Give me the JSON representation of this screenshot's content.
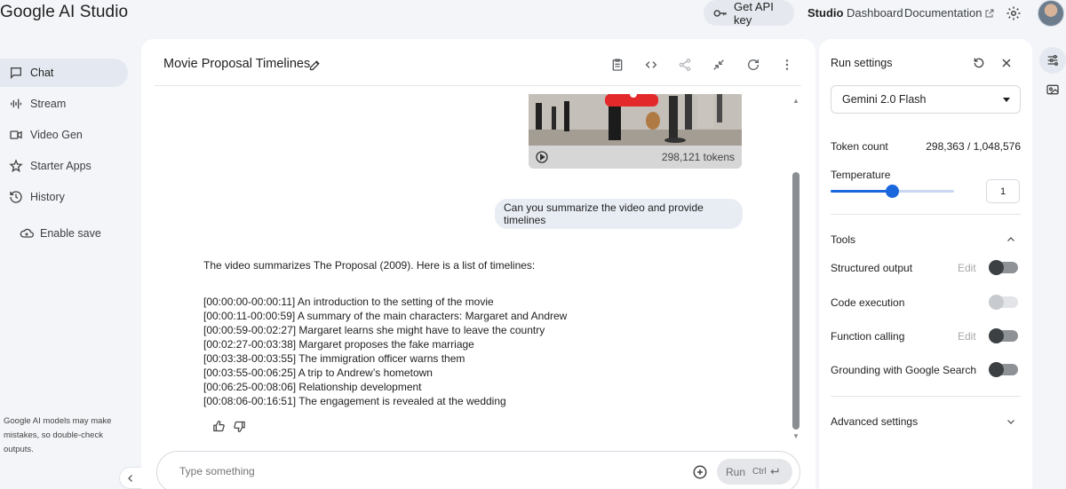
{
  "app": {
    "logo": "Google AI Studio"
  },
  "header": {
    "api_key_label": "Get API key",
    "nav": {
      "studio": "Studio",
      "dashboard": "Dashboard",
      "documentation": "Documentation"
    }
  },
  "sidebar": {
    "items": [
      {
        "label": "Chat",
        "icon": "chat-icon",
        "active": true
      },
      {
        "label": "Stream",
        "icon": "waveform-icon"
      },
      {
        "label": "Video Gen",
        "icon": "video-camera-icon"
      },
      {
        "label": "Starter Apps",
        "icon": "starter-apps-icon"
      },
      {
        "label": "History",
        "icon": "history-icon"
      }
    ],
    "enable_save": "Enable save",
    "disclaimer": "Google AI models may make mistakes, so double-check outputs."
  },
  "chat": {
    "title": "Movie Proposal Timelines",
    "video_tokens": "298,121 tokens",
    "user_message": "Can you summarize the video and provide timelines",
    "model_intro": "The video summarizes The Proposal (2009). Here is a list of timelines:",
    "timeline": [
      "[00:00:00-00:00:11] An introduction to the setting of the movie",
      "[00:00:11-00:00:59] A summary of the main characters: Margaret and Andrew",
      "[00:00:59-00:02:27] Margaret learns she might have to leave the country",
      "[00:02:27-00:03:38] Margaret proposes the fake marriage",
      "[00:03:38-00:03:55] The immigration officer warns them",
      "[00:03:55-00:06:25] A trip to Andrew’s hometown",
      "[00:06:25-00:08:06] Relationship development",
      "[00:08:06-00:16:51] The engagement is revealed at the wedding"
    ],
    "composer_placeholder": "Type something",
    "run_label": "Run",
    "run_shortcut": "Ctrl"
  },
  "run_settings": {
    "title": "Run settings",
    "model": "Gemini 2.0 Flash",
    "token_count_label": "Token count",
    "token_count_value": "298,363 / 1,048,576",
    "temperature_label": "Temperature",
    "temperature_value": "1",
    "temperature_fraction": 0.5,
    "tools_label": "Tools",
    "tools": [
      {
        "label": "Structured output",
        "edit": "Edit",
        "enabled": false,
        "disabled": false
      },
      {
        "label": "Code execution",
        "edit": "",
        "enabled": false,
        "disabled": true
      },
      {
        "label": "Function calling",
        "edit": "Edit",
        "enabled": false,
        "disabled": false
      },
      {
        "label": "Grounding with Google Search",
        "edit": "",
        "enabled": false,
        "disabled": false
      }
    ],
    "advanced_label": "Advanced settings"
  },
  "colors": {
    "accent": "#1a66dc",
    "panel_bg": "#ffffff",
    "page_bg": "#f3f5f8"
  }
}
